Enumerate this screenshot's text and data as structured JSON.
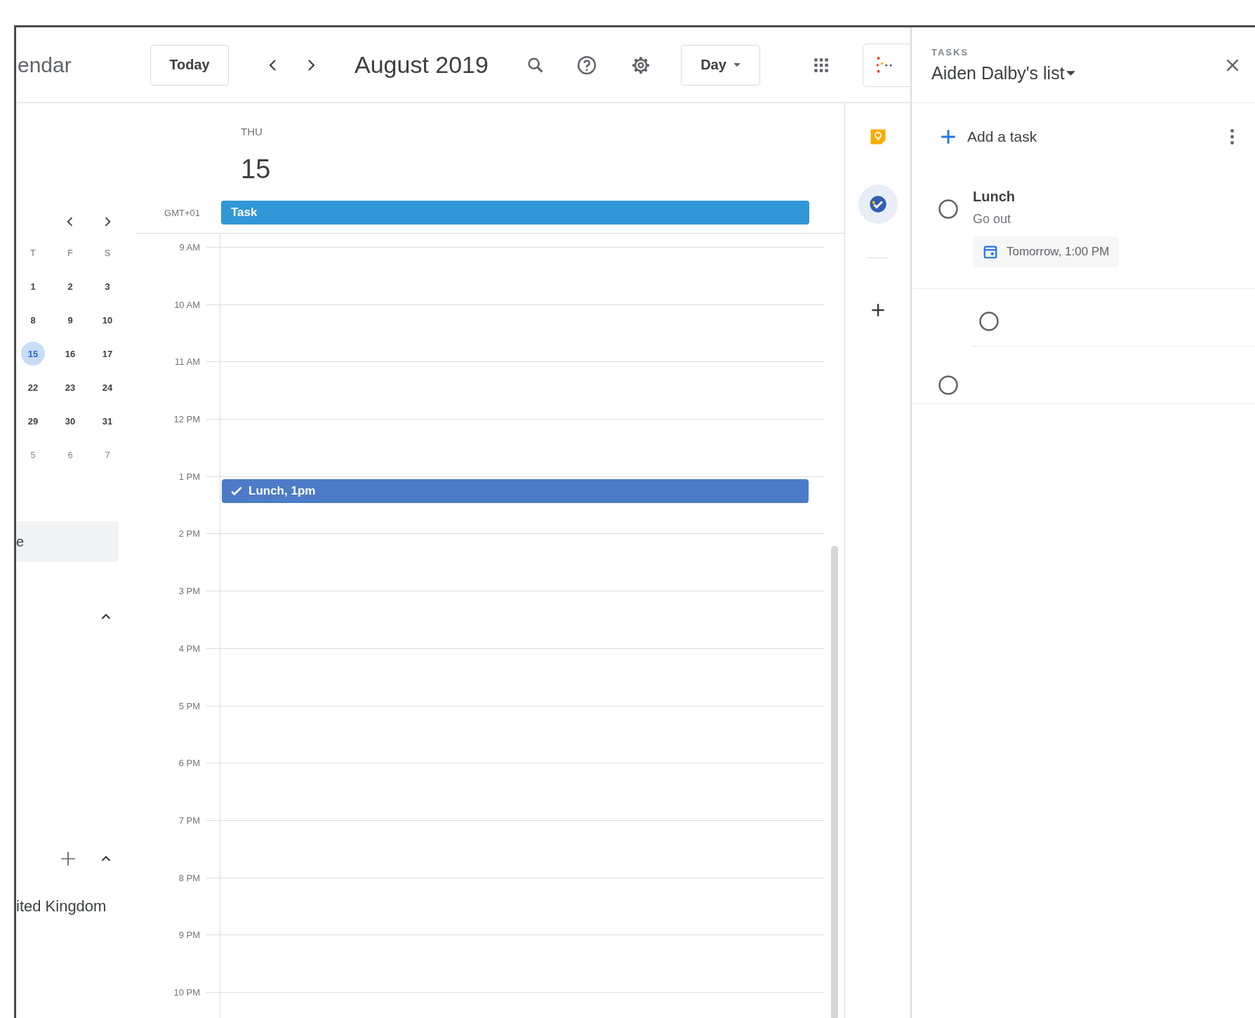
{
  "header": {
    "app_title": "endar",
    "today_button": "Today",
    "month_title": "August 2019",
    "view_dropdown": "Day"
  },
  "mini_calendar": {
    "weekdays": [
      "T",
      "F",
      "S"
    ],
    "weeks": [
      [
        {
          "label": "1",
          "selected": false,
          "outside_month": false
        },
        {
          "label": "2",
          "selected": false,
          "outside_month": false
        },
        {
          "label": "3",
          "selected": false,
          "outside_month": false
        }
      ],
      [
        {
          "label": "8",
          "selected": false,
          "outside_month": false
        },
        {
          "label": "9",
          "selected": false,
          "outside_month": false
        },
        {
          "label": "10",
          "selected": false,
          "outside_month": false
        }
      ],
      [
        {
          "label": "15",
          "selected": true,
          "outside_month": false
        },
        {
          "label": "16",
          "selected": false,
          "outside_month": false
        },
        {
          "label": "17",
          "selected": false,
          "outside_month": false
        }
      ],
      [
        {
          "label": "22",
          "selected": false,
          "outside_month": false
        },
        {
          "label": "23",
          "selected": false,
          "outside_month": false
        },
        {
          "label": "24",
          "selected": false,
          "outside_month": false
        }
      ],
      [
        {
          "label": "29",
          "selected": false,
          "outside_month": false
        },
        {
          "label": "30",
          "selected": false,
          "outside_month": false
        },
        {
          "label": "31",
          "selected": false,
          "outside_month": false
        }
      ],
      [
        {
          "label": "5",
          "selected": false,
          "outside_month": true
        },
        {
          "label": "6",
          "selected": false,
          "outside_month": true
        },
        {
          "label": "7",
          "selected": false,
          "outside_month": true
        }
      ]
    ]
  },
  "search_field": {
    "placeholder": "e"
  },
  "my_calendars": {
    "expanded": true
  },
  "other_calendars": {
    "expanded": true,
    "calendars": [
      {
        "label": "ited Kingdom"
      }
    ]
  },
  "day_view": {
    "weekday": "THU",
    "date": "15",
    "timezone": "GMT+01",
    "all_day_events": [
      {
        "title": "Task",
        "color": "#3197d6"
      }
    ],
    "hours": [
      {
        "label": "9 AM"
      },
      {
        "label": "10 AM"
      },
      {
        "label": "11 AM"
      },
      {
        "label": "12 PM"
      },
      {
        "label": "1 PM",
        "events": [
          {
            "title": "Lunch, 1pm",
            "kind": "task",
            "color": "#4e7bc8"
          }
        ]
      },
      {
        "label": "2 PM"
      },
      {
        "label": "3 PM"
      },
      {
        "label": "4 PM"
      },
      {
        "label": "5 PM"
      },
      {
        "label": "6 PM"
      },
      {
        "label": "7 PM"
      },
      {
        "label": "8 PM"
      },
      {
        "label": "9 PM"
      },
      {
        "label": "10 PM"
      }
    ]
  },
  "side_panel": {
    "items": [
      {
        "kind": "keep",
        "selected": false
      },
      {
        "kind": "tasks",
        "selected": true
      },
      {
        "kind": "add",
        "selected": false
      }
    ]
  },
  "tasks_panel": {
    "label": "TASKS",
    "list_name": "Aiden Dalby's list",
    "add_task": "Add a task",
    "tasks": [
      {
        "title": "Lunch",
        "notes": "Go out",
        "due": "Tomorrow, 1:00 PM",
        "completed": false,
        "children": [
          {
            "completed": false
          }
        ]
      },
      {
        "completed": false
      }
    ]
  }
}
